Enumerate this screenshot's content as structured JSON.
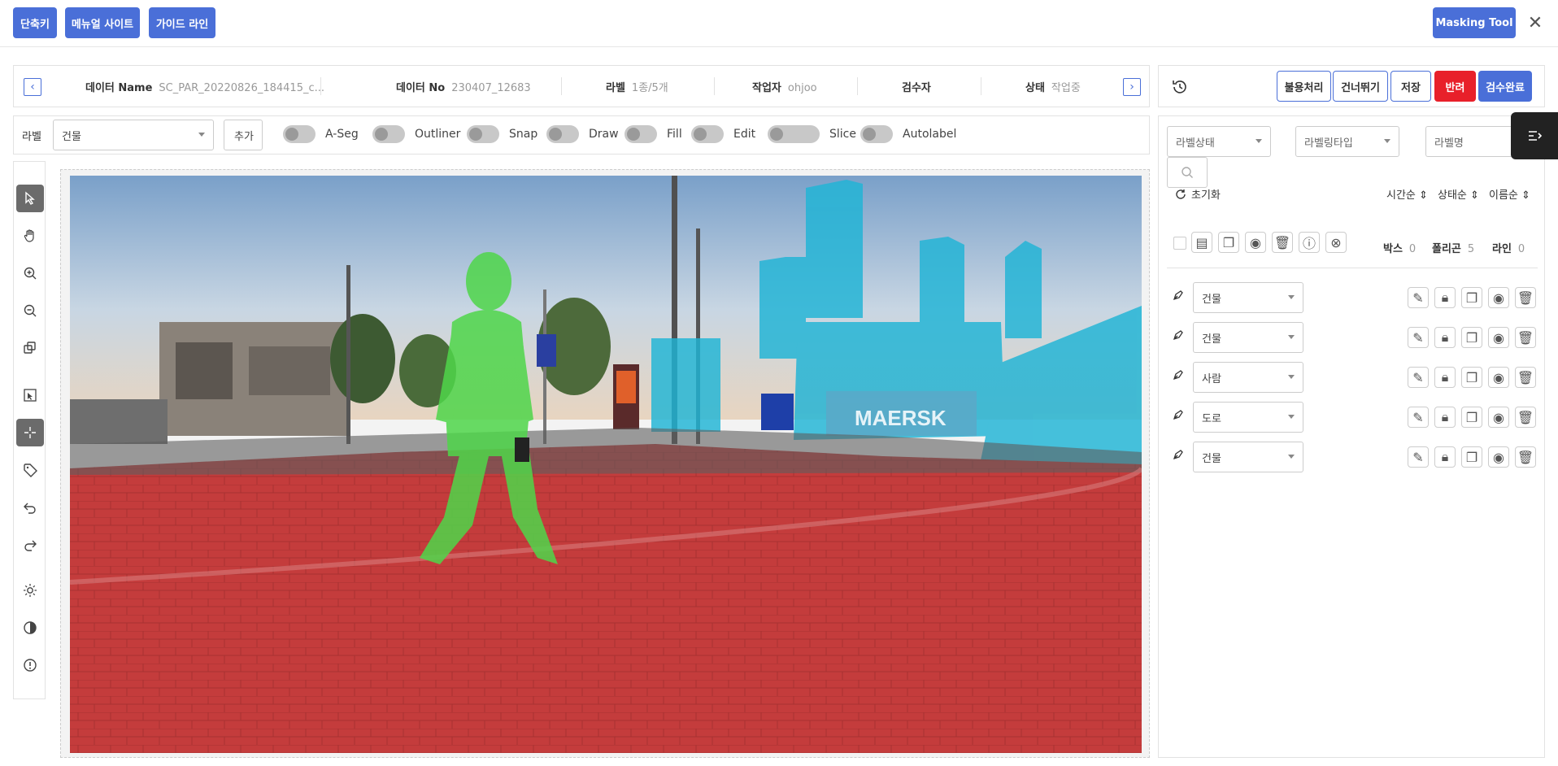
{
  "topbar": {
    "shortcut": "단축키",
    "manual_site": "메뉴얼 사이트",
    "guide_line": "가이드 라인",
    "masking_tool": "Masking Tool",
    "close": "✕"
  },
  "info": {
    "data_name_label": "데이터 Name",
    "data_name_value": "SC_PAR_20220826_184415_c...",
    "data_no_label": "데이터 No",
    "data_no_value": "230407_12683",
    "label_label": "라벨",
    "label_value": "1종/5개",
    "worker_label": "작업자",
    "worker_value": "ohjoo",
    "inspector_label": "검수자",
    "inspector_value": "",
    "status_label": "상태",
    "status_value": "작업중"
  },
  "options": {
    "label_title": "라벨",
    "label_selected": "건물",
    "add_button": "추가",
    "toggles": [
      "A-Seg",
      "Outliner",
      "Snap",
      "Draw",
      "Fill",
      "Edit",
      "Slice",
      "Autolabel"
    ]
  },
  "actions": {
    "unusable": "불용처리",
    "skip": "건너뛰기",
    "save": "저장",
    "reject": "반려",
    "inspect_done": "검수완료"
  },
  "filters": {
    "label_status": "라벨상태",
    "labeling_type": "라벨링타입",
    "label_name_placeholder": "라벨명"
  },
  "sorting": {
    "reset": "초기화",
    "time": "시간순",
    "status": "상태순",
    "name": "이름순"
  },
  "counts": {
    "box_label": "박스",
    "box_value": "0",
    "polygon_label": "폴리곤",
    "polygon_value": "5",
    "line_label": "라인",
    "line_value": "0"
  },
  "labels": [
    {
      "name": "건물"
    },
    {
      "name": "건물"
    },
    {
      "name": "사람"
    },
    {
      "name": "도로"
    },
    {
      "name": "건물"
    }
  ],
  "scene_text": {
    "truck_brand": "MAERSK"
  },
  "colors": {
    "primary": "#4a6fd8",
    "reject": "#e8202a",
    "mask_building": "#1fb4d6",
    "mask_person": "#4fd64a",
    "mask_road": "#c83a3a"
  }
}
